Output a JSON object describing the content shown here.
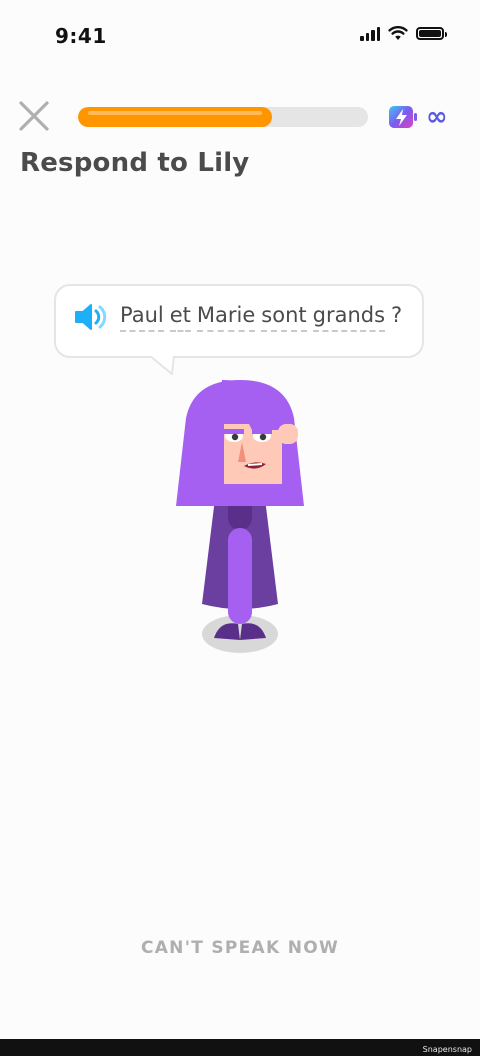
{
  "status_bar": {
    "time": "9:41"
  },
  "header": {
    "progress_fraction": 0.67,
    "energy_label": "∞"
  },
  "prompt": {
    "title": "Respond to Lily"
  },
  "bubble": {
    "words": [
      "Paul",
      "et",
      "Marie",
      "sont",
      "grands"
    ],
    "punctuation": "?"
  },
  "footer": {
    "cant_speak_label": "CAN'T SPEAK NOW"
  },
  "watermark": "Snapensnap",
  "colors": {
    "accent": "#ff9600",
    "character_hair": "#a560f2",
    "character_dress": "#6b3fa0",
    "speaker": "#1cb0f6",
    "infinity": "#5a5ae6"
  }
}
